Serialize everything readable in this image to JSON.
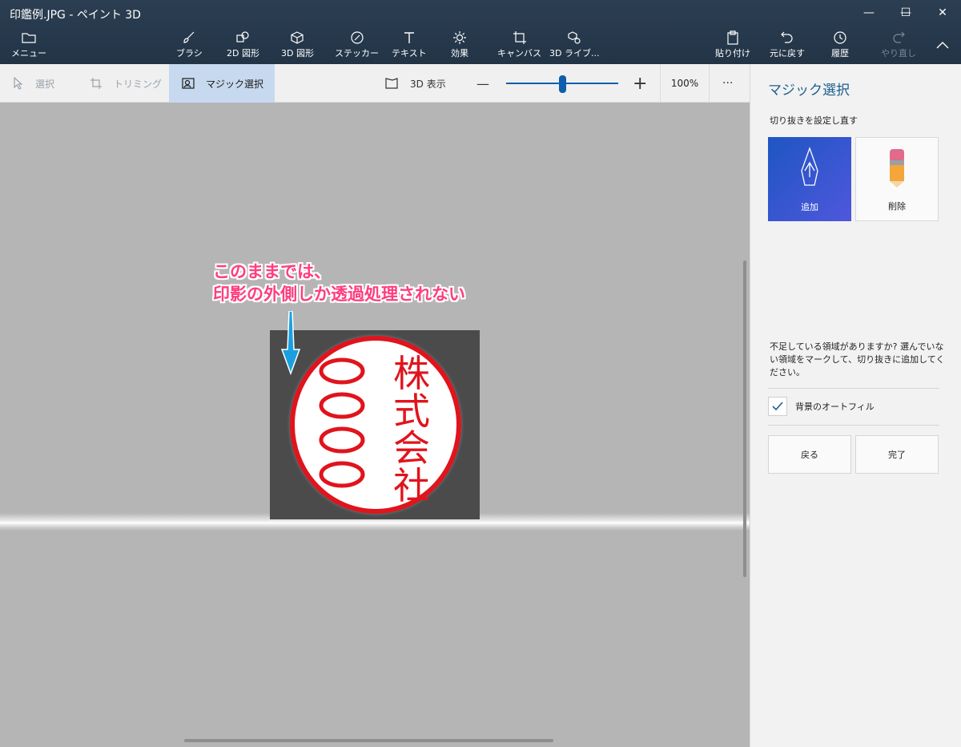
{
  "window": {
    "title": "印鑑例.JPG - ペイント 3D",
    "minimize_glyph": "—",
    "maximize_glyph": "☐",
    "close_glyph": "✕"
  },
  "ribbon": {
    "menu": "メニュー",
    "tools": [
      "ブラシ",
      "2D 図形",
      "3D 図形",
      "ステッカー",
      "テキスト",
      "効果",
      "キャンバス",
      "3D ライブ..."
    ],
    "paste": "貼り付け",
    "undo": "元に戻す",
    "history": "履歴",
    "redo": "やり直し"
  },
  "subbar": {
    "select": "選択",
    "crop": "トリミング",
    "magic_select": "マジック選択",
    "view_3d": "3D 表示",
    "zoom_minus": "—",
    "zoom_plus": "+",
    "zoom_level": "100%",
    "zoom_fraction": 0.5,
    "more": "···"
  },
  "canvas": {
    "annotation_line1": "このままでは、",
    "annotation_line2": "印影の外側しか透過処理されない",
    "stamp_left": [
      "〇",
      "〇",
      "〇",
      "〇"
    ],
    "stamp_right": [
      "株",
      "式",
      "会",
      "社"
    ],
    "arrow_color": "#1aa0e0",
    "stamp_color": "#e0141c"
  },
  "panel": {
    "title": "マジック選択",
    "subtitle": "切り抜きを設定し直す",
    "add_label": "追加",
    "delete_label": "削除",
    "help_text": "不足している領域がありますか? 選んでいない領域をマークして、切り抜きに追加してください。",
    "autofill_label": "背景のオートフィル",
    "autofill_checked": true,
    "back_label": "戻る",
    "done_label": "完了"
  }
}
